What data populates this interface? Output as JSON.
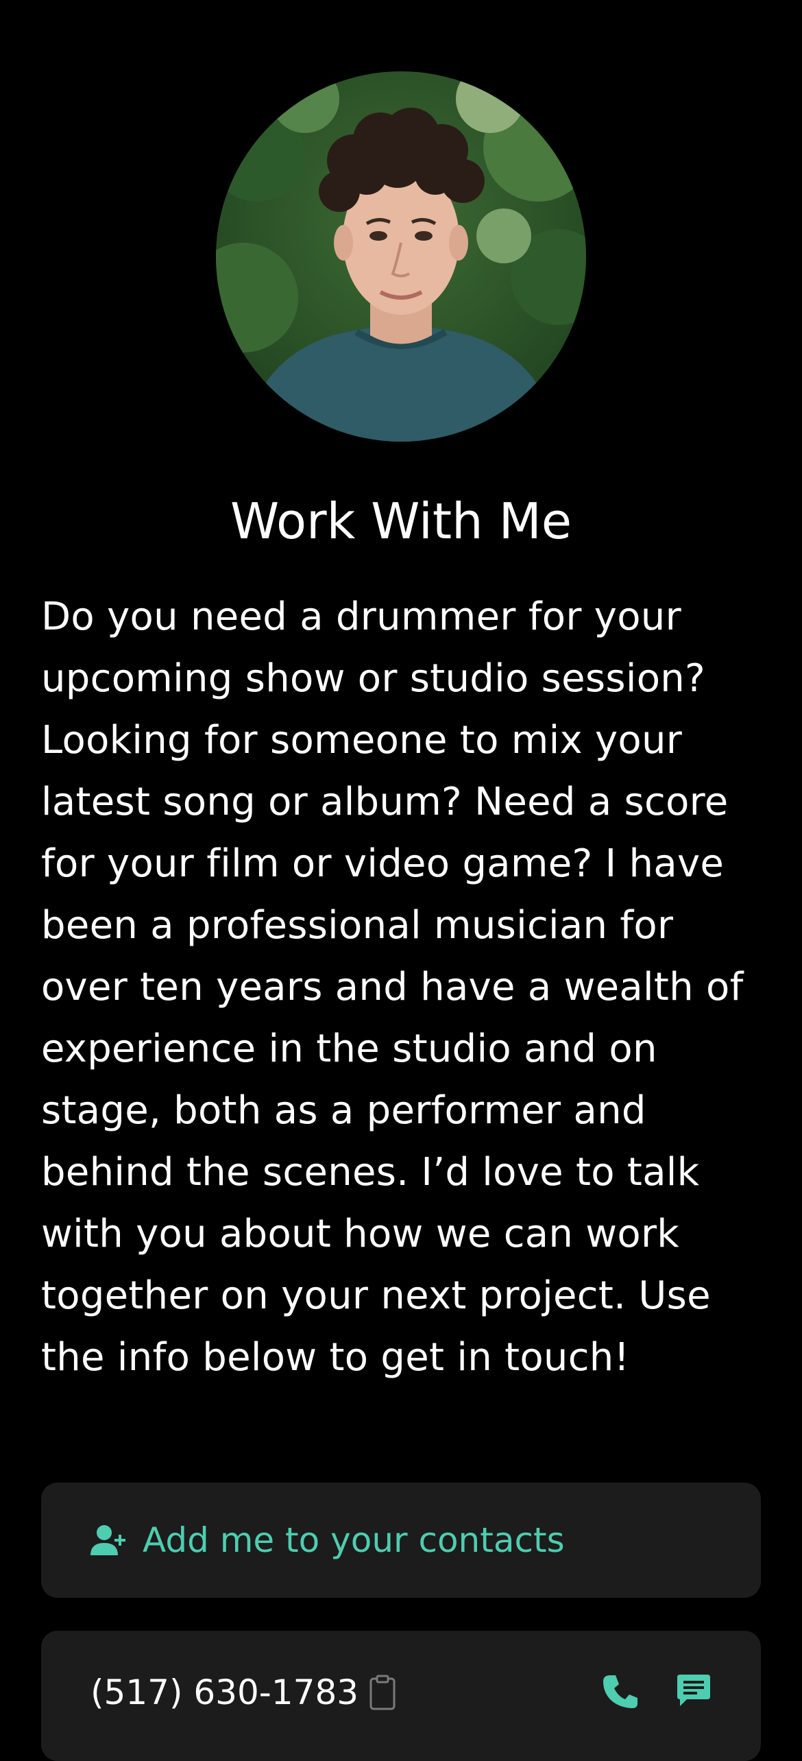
{
  "profile": {
    "avatar_icon": "profile-photo"
  },
  "title": "Work With Me",
  "bio": "Do you need a drummer for your upcoming show or studio session? Looking for someone to mix your latest song or album? Need a score for your film or video game? I have been a professional musician for over ten years and have a wealth of experience in the studio and on stage, both as a performer and behind the scenes. I’d love to talk with you about how we can work together on your next project. Use the info below to get in touch!",
  "contacts_card": {
    "label": "Add me to your contacts",
    "icon": "add-user-icon"
  },
  "phone_card": {
    "number": "(517) 630-1783",
    "copy_icon": "clipboard-icon",
    "call_icon": "phone-icon",
    "sms_icon": "message-icon"
  },
  "colors": {
    "background": "#000000",
    "card": "#1c1c1c",
    "accent": "#4ecdb0",
    "text": "#ffffff"
  }
}
